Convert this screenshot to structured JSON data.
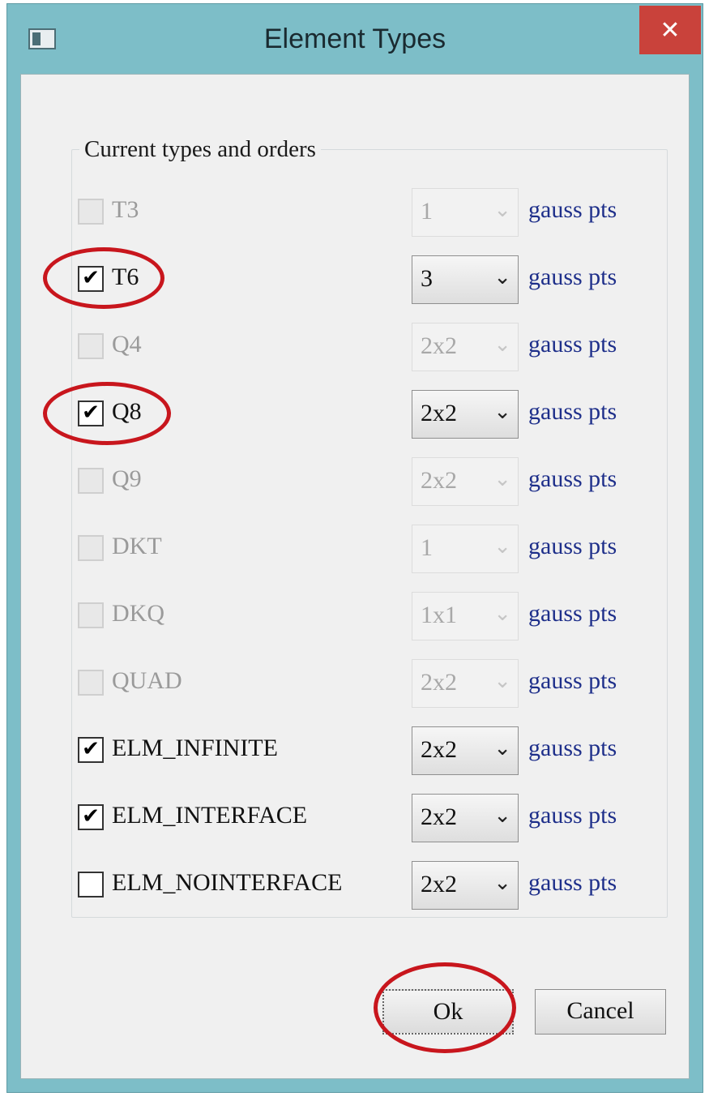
{
  "window": {
    "title": "Element Types",
    "icon": "app-window-icon",
    "close_glyph": "✕"
  },
  "group": {
    "label": "Current types and orders"
  },
  "rows": [
    {
      "label": "T3",
      "checked": false,
      "enabled": false,
      "order": "1",
      "unit": "gauss pts"
    },
    {
      "label": "T6",
      "checked": true,
      "enabled": true,
      "order": "3",
      "unit": "gauss pts"
    },
    {
      "label": "Q4",
      "checked": false,
      "enabled": false,
      "order": "2x2",
      "unit": "gauss pts"
    },
    {
      "label": "Q8",
      "checked": true,
      "enabled": true,
      "order": "2x2",
      "unit": "gauss pts"
    },
    {
      "label": "Q9",
      "checked": false,
      "enabled": false,
      "order": "2x2",
      "unit": "gauss pts"
    },
    {
      "label": "DKT",
      "checked": false,
      "enabled": false,
      "order": "1",
      "unit": "gauss pts"
    },
    {
      "label": "DKQ",
      "checked": false,
      "enabled": false,
      "order": "1x1",
      "unit": "gauss pts"
    },
    {
      "label": "QUAD",
      "checked": false,
      "enabled": false,
      "order": "2x2",
      "unit": "gauss pts"
    },
    {
      "label": "ELM_INFINITE",
      "checked": true,
      "enabled": true,
      "order": "2x2",
      "unit": "gauss pts"
    },
    {
      "label": "ELM_INTERFACE",
      "checked": true,
      "enabled": true,
      "order": "2x2",
      "unit": "gauss pts"
    },
    {
      "label": "ELM_NOINTERFACE",
      "checked": false,
      "enabled": true,
      "order": "2x2",
      "unit": "gauss pts"
    }
  ],
  "glyphs": {
    "check": "✔",
    "dropdown_arrow": "⌄"
  },
  "buttons": {
    "ok": "Ok",
    "cancel": "Cancel"
  },
  "annotations": {
    "color": "#c8161d",
    "circled_items": [
      "T6",
      "Q8",
      "Ok"
    ]
  }
}
